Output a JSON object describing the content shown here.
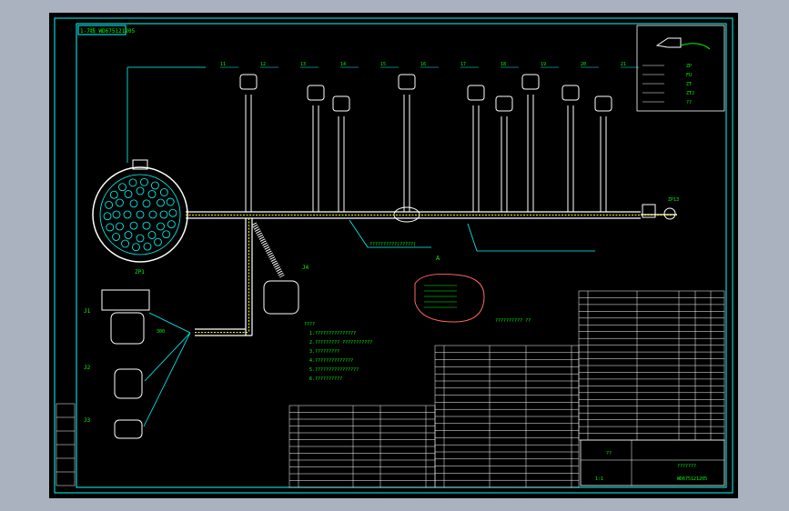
{
  "drawing": {
    "title_tag": "1-7线 WD675121205",
    "connector_main_label": "ZP1",
    "branch_labels": [
      "11",
      "12",
      "13",
      "14",
      "15",
      "16",
      "17",
      "18",
      "19",
      "20",
      "21"
    ],
    "bundle_note": "??????????(?????)",
    "wire_no_left": "300",
    "label_side_1": "J1",
    "label_side_2": "J2",
    "label_side_3": "J3",
    "label_bottom_conn": "J4",
    "detail_label": "A",
    "detail_caption": "?????????? ??",
    "right_end_label": "ZP13",
    "notes_title": "????",
    "notes_lines": [
      "1.???????????????",
      "2.????????? ???????????",
      "3.?????????",
      "4.??????????????",
      "5.????????????????",
      "6.??????????"
    ]
  },
  "legend": {
    "items": [
      "ZP",
      "FU",
      "ZT",
      "ZTJ",
      "??"
    ]
  },
  "title_block": {
    "drawing_no": "WD675121205",
    "part_name": "???????",
    "scale": "1:1",
    "sheet": "??"
  },
  "colors": {
    "background": "#000000",
    "frame": "#00ffff",
    "wire": "#ffffff",
    "text": "#00ff00",
    "highlight": "#ff00ff",
    "bg_outer": "#a9b2be"
  }
}
